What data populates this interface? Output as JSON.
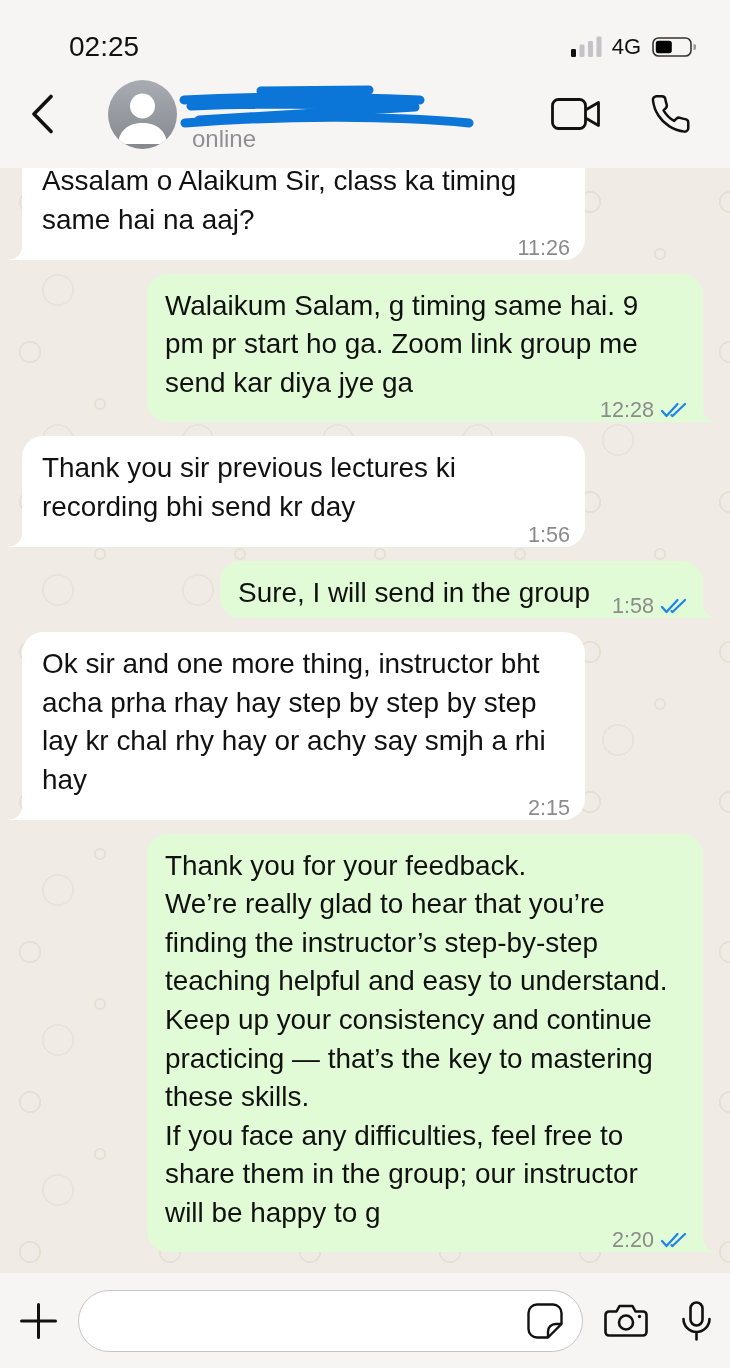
{
  "status_bar": {
    "time": "02:25",
    "network": "4G"
  },
  "header": {
    "contact_status": "online"
  },
  "messages": [
    {
      "kind": "incoming",
      "text": "Assalam o Alaikum Sir, class ka timing same hai na aaj?",
      "time": "11:26"
    },
    {
      "kind": "outgoing",
      "text": "Walaikum Salam, g timing same hai. 9 pm pr start ho ga. Zoom link group me send kar diya jye ga",
      "time": "12:28",
      "read": true
    },
    {
      "kind": "incoming",
      "text": "Thank you sir previous lectures ki recording bhi send kr day",
      "time": "1:56"
    },
    {
      "kind": "outgoing",
      "text": "Sure, I will send in the group",
      "time": "1:58",
      "read": true
    },
    {
      "kind": "incoming",
      "text": "Ok sir and one more thing, instructor bht acha prha rhay hay step by step by step lay kr chal rhy hay or achy say smjh a rhi hay",
      "time": "2:15"
    },
    {
      "kind": "outgoing",
      "text": "Thank you for your feedback.\nWe’re really glad to hear that you’re finding the instructor’s step-by-step teaching helpful and easy to understand.\nKeep up your consistency and continue practicing — that’s the key to mastering these skills.\nIf you face any difficulties, feel free to share them in the group; our instructor will be happy to g",
      "time": "2:20",
      "read": true
    }
  ]
}
